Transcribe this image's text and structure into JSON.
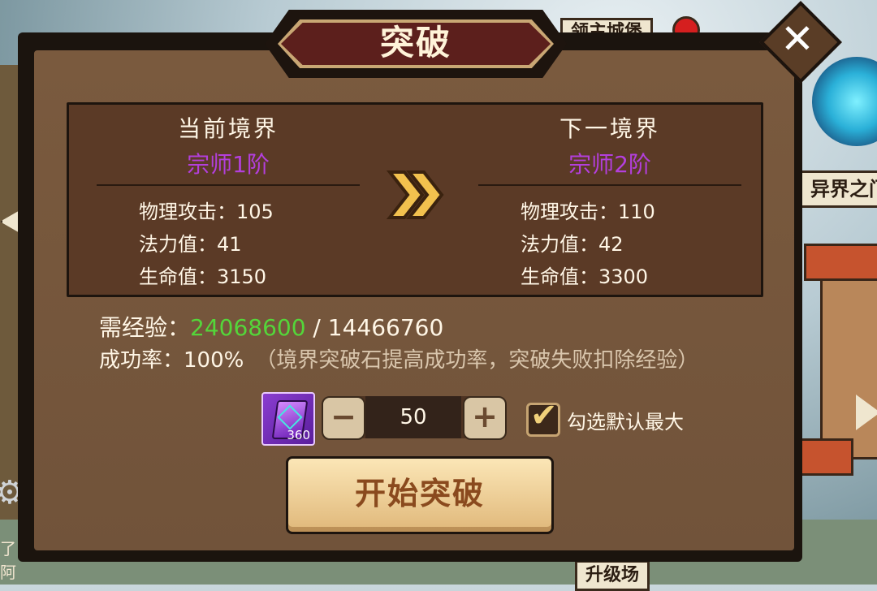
{
  "background": {
    "label_top": "领主城堡",
    "label_right": "异界之门",
    "label_bottom": "升级场",
    "chat_peek": "了\n阿"
  },
  "dialog": {
    "title": "突破",
    "close_symbol": "✕"
  },
  "current": {
    "heading": "当前境界",
    "realm": "宗师1阶",
    "stats": [
      {
        "text": "物理攻击：105"
      },
      {
        "text": "法力值：41"
      },
      {
        "text": "生命值：3150"
      }
    ]
  },
  "next": {
    "heading": "下一境界",
    "realm": "宗师2阶",
    "stats": [
      {
        "text": "物理攻击：110"
      },
      {
        "text": "法力值：42"
      },
      {
        "text": "生命值：3300"
      }
    ]
  },
  "exp": {
    "label": "需经验：",
    "current": "24068600",
    "separator": " / ",
    "required": "14466760"
  },
  "rate": {
    "label": "成功率：",
    "value": "100%",
    "note": "（境界突破石提高成功率，突破失败扣除经验）"
  },
  "item": {
    "count": "360",
    "icon": "breakthrough-stone-icon"
  },
  "stepper": {
    "minus": "−",
    "value": "50",
    "plus": "+"
  },
  "checkbox": {
    "checked": true,
    "label": "勾选默认最大"
  },
  "start_button": {
    "label": "开始突破"
  },
  "colors": {
    "realm": "#b33fdc",
    "exp_current": "#54d63a",
    "panel": "#7a5a3e",
    "title_banner": "#5c1f1c",
    "button": "#f3d59c"
  }
}
